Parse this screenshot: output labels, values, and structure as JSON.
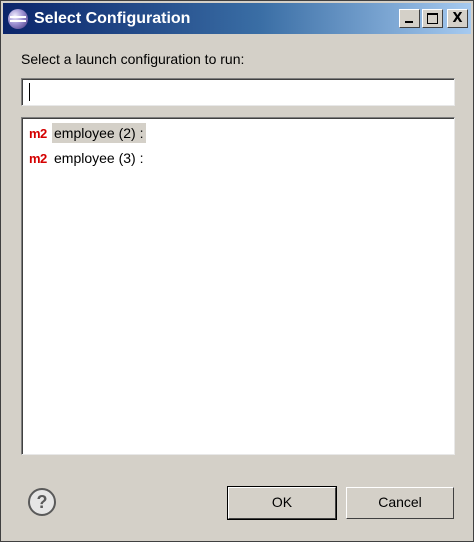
{
  "window": {
    "title": "Select Configuration",
    "controls": {
      "minimize": "",
      "maximize": "",
      "close": "X"
    }
  },
  "prompt": "Select a launch configuration to run:",
  "filter": {
    "value": ""
  },
  "configurations": [
    {
      "icon_text": "m2",
      "label": "employee (2) :",
      "selected": true
    },
    {
      "icon_text": "m2",
      "label": "employee (3) :",
      "selected": false
    }
  ],
  "buttons": {
    "help": "?",
    "ok": "OK",
    "cancel": "Cancel"
  },
  "colors": {
    "accent": "#0a246a",
    "maven_icon": "#d40000",
    "dialog_bg": "#d4d0c8"
  }
}
